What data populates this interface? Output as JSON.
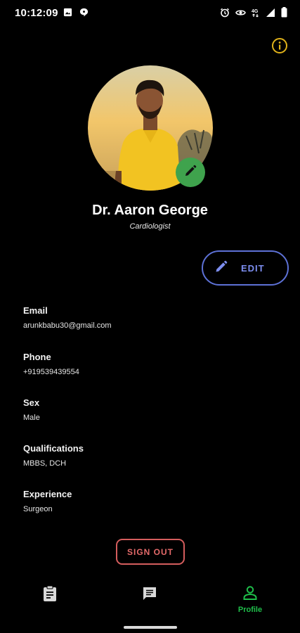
{
  "status_bar": {
    "time": "10:12:09",
    "left_icons": [
      "image-icon",
      "chat-bubble-icon"
    ],
    "right_icons": [
      "alarm-icon",
      "eye-icon",
      "signal-4g-icon",
      "cell-signal-icon",
      "battery-icon"
    ]
  },
  "header": {
    "info_icon": "info-icon",
    "info_color": "#e0b21a"
  },
  "profile": {
    "name": "Dr. Aaron George",
    "specialty": "Cardiologist",
    "avatar_edit_color": "#3fa34d"
  },
  "actions": {
    "edit_label": "EDIT",
    "edit_color": "#5d71d6",
    "sign_out_label": "SIGN OUT",
    "sign_out_color": "#d45d5d"
  },
  "details": [
    {
      "label": "Email",
      "value": "arunkbabu30@gmail.com"
    },
    {
      "label": "Phone",
      "value": "+919539439554"
    },
    {
      "label": "Sex",
      "value": "Male"
    },
    {
      "label": "Qualifications",
      "value": "MBBS, DCH"
    },
    {
      "label": "Experience",
      "value": "Surgeon"
    }
  ],
  "bottom_nav": {
    "items": [
      {
        "icon": "clipboard-icon",
        "label": ""
      },
      {
        "icon": "message-icon",
        "label": ""
      },
      {
        "icon": "person-icon",
        "label": "Profile",
        "active": true
      }
    ],
    "active_color": "#1fbf4a"
  }
}
